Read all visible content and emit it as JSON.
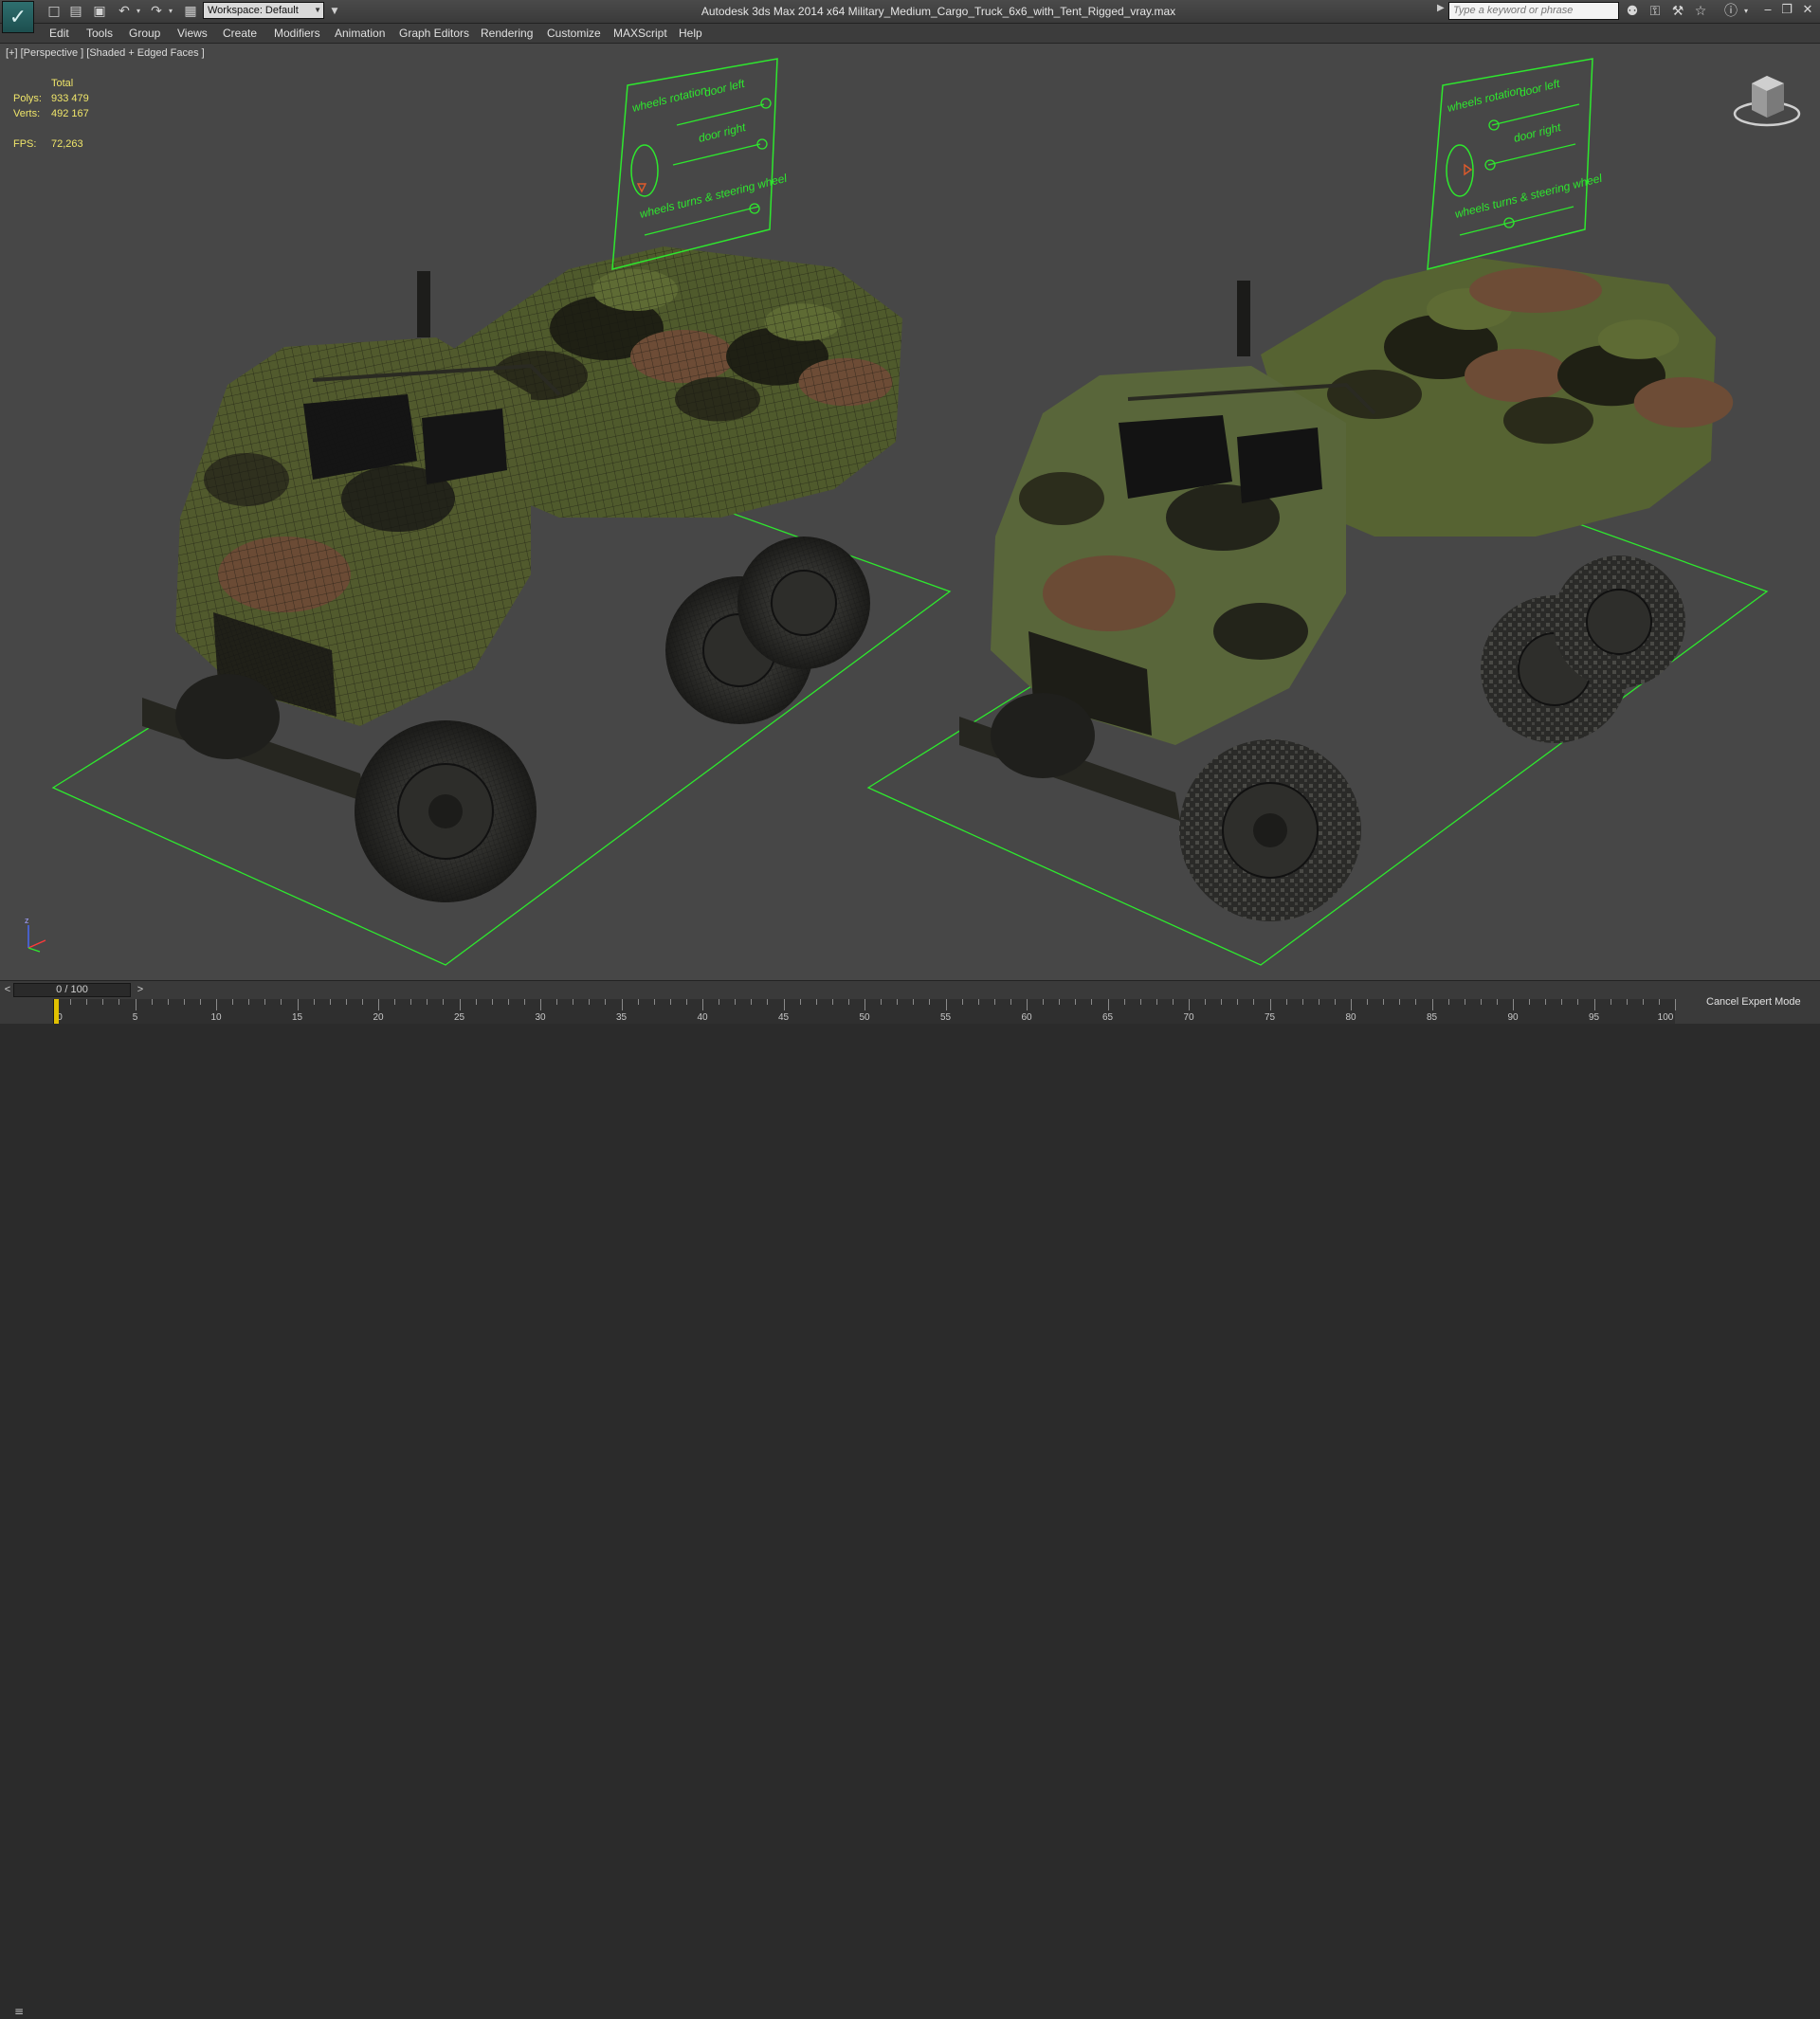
{
  "window": {
    "title": "Autodesk 3ds Max  2014 x64     Military_Medium_Cargo_Truck_6x6_with_Tent_Rigged_vray.max",
    "workspace_label": "Workspace: Default",
    "search_placeholder": "Type a keyword or phrase"
  },
  "menu": {
    "items": [
      "Edit",
      "Tools",
      "Group",
      "Views",
      "Create",
      "Modifiers",
      "Animation",
      "Graph Editors",
      "Rendering",
      "Customize",
      "MAXScript",
      "Help"
    ]
  },
  "viewport": {
    "label": "[+] [Perspective ] [Shaded + Edged Faces ]",
    "stats": {
      "total_label": "Total",
      "polys_label": "Polys:",
      "polys_value": "933 479",
      "verts_label": "Verts:",
      "verts_value": "492 167",
      "fps_label": "FPS:",
      "fps_value": "72,263"
    },
    "rig_panel": {
      "wheels_rotation": "wheels rotation",
      "door_left": "door left",
      "door_right": "door right",
      "wheels_turns": "wheels turns & steering wheel"
    }
  },
  "timeline": {
    "slider_label": "0 / 100",
    "ticks": [
      "0",
      "5",
      "10",
      "15",
      "20",
      "25",
      "30",
      "35",
      "40",
      "45",
      "50",
      "55",
      "60",
      "65",
      "70",
      "75",
      "80",
      "85",
      "90",
      "95",
      "100"
    ]
  },
  "status": {
    "cancel_expert_mode": "Cancel Expert Mode"
  },
  "colors": {
    "grid_green": "#2ee82e",
    "camo_green": "#4c5a2a",
    "camo_brown": "#6b4b35",
    "camo_black": "#1e1e14",
    "stats_yellow": "#f0e66a"
  },
  "icons": {
    "logo": "3ds-max-logo-icon",
    "viewcube": "viewcube-icon"
  }
}
